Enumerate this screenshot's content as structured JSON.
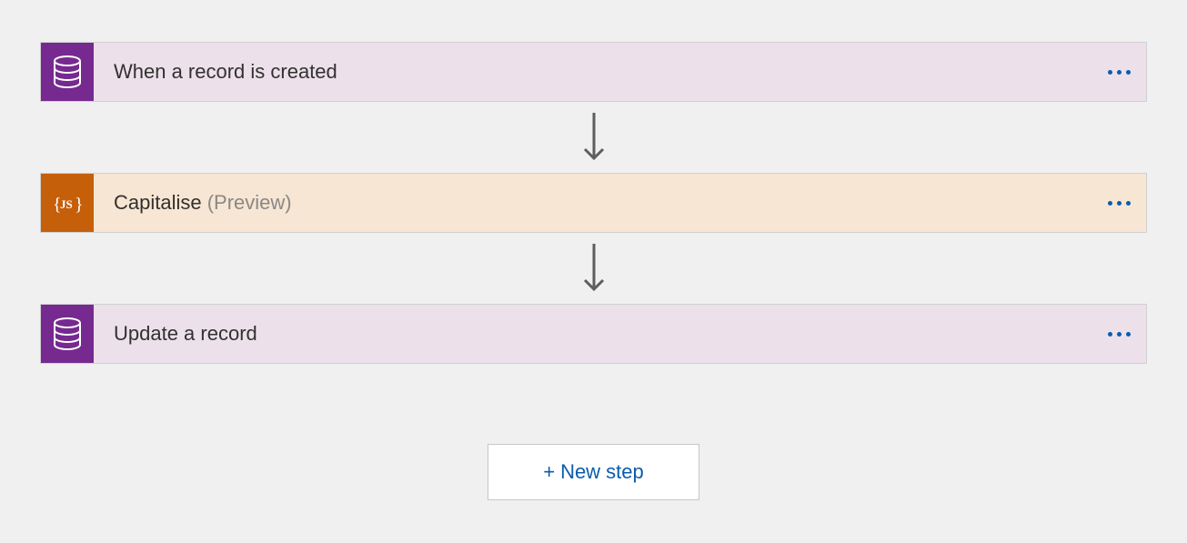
{
  "steps": [
    {
      "title": "When a record is created",
      "preview": "",
      "iconType": "database",
      "iconColor": "purple",
      "cardColor": "purple"
    },
    {
      "title": "Capitalise",
      "preview": "(Preview)",
      "iconType": "js",
      "iconColor": "orange",
      "cardColor": "orange"
    },
    {
      "title": "Update a record",
      "preview": "",
      "iconType": "database",
      "iconColor": "purple",
      "cardColor": "purple"
    }
  ],
  "newStepButton": {
    "label": "New step",
    "prefix": "+"
  }
}
